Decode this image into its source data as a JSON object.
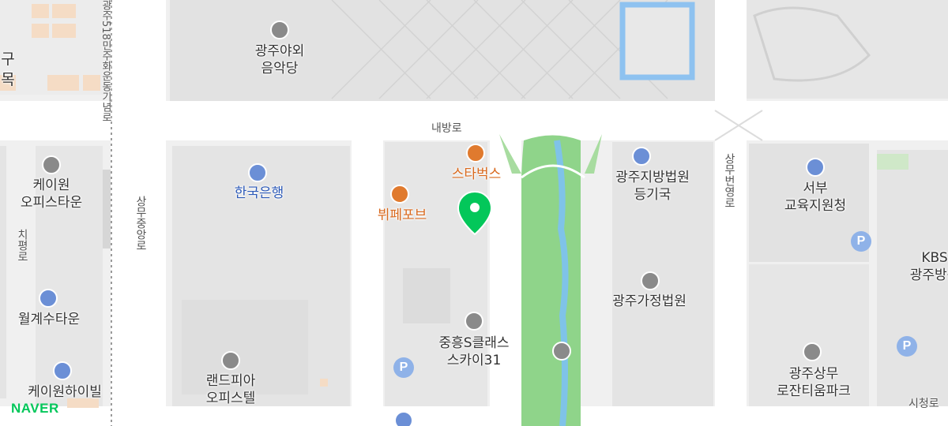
{
  "brand": {
    "logo_text": "NAVER"
  },
  "places": {
    "outdoor_music_hall": "광주야외\n음악당",
    "bank_of_korea": "한국은행",
    "starbucks": "스타벅스",
    "buffet": "뷔페포브",
    "court_registry": "광주지방법원\n등기국",
    "education_office": "서부\n교육지원청",
    "kbs": "KBS\n광주방송",
    "family_court": "광주가정법원",
    "kwon_office": "케이원\n오피스타운",
    "wolgye": "월계수타운",
    "kwon_highville": "케이원하이빌",
    "landpia": "랜드피아\n오피스텔",
    "jungheung": "중흥S클래스\n스카이31",
    "sangmu_lozanti": "광주상무\n로잔티움파크",
    "gu_mok": "구\n목"
  },
  "roads": {
    "naebang_ro": "내방로",
    "sangmu_jungang_ro": "상무중앙로",
    "sangmu_beonyeong_ro": "상무번영로",
    "chipyeong_ro": "치평로",
    "sicheong_ro": "시청로",
    "memorial_road": "광주518민주화운동기념로"
  },
  "badges": {
    "parking": "P"
  },
  "icon_names": [
    "theater-icon",
    "bank-icon",
    "cafe-icon",
    "restaurant-icon",
    "office-icon",
    "building-icon",
    "court-icon",
    "apartment-icon",
    "parking-icon",
    "location-pin-icon",
    "bridge-icon"
  ],
  "colors": {
    "accent": "#03c75a",
    "park": "#8fd48a",
    "water": "#7fc3e8",
    "cafe": "#e07a2e",
    "road": "#ffffff",
    "block": "#e7e7e7"
  }
}
